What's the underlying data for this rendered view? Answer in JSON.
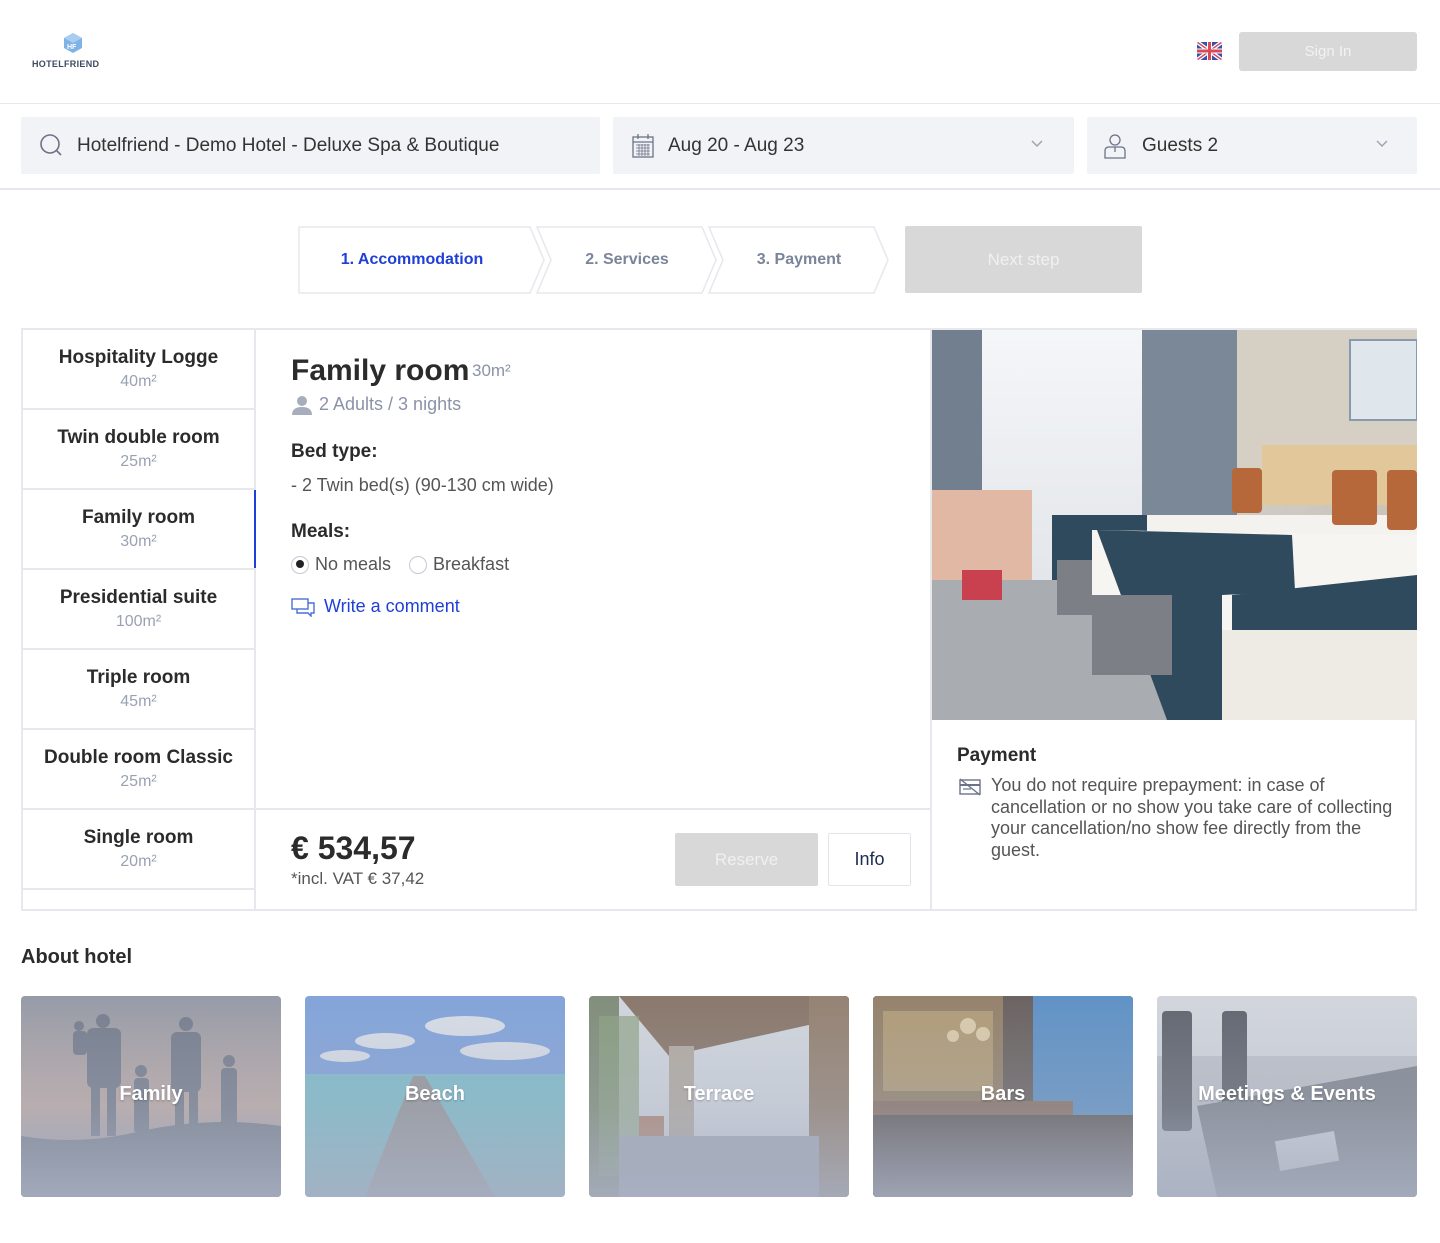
{
  "header": {
    "logo_text": "HOTELFRIEND",
    "language": "English (UK)",
    "sign_in_label": "Sign In"
  },
  "search": {
    "hotel": "Hotelfriend - Demo Hotel - Deluxe Spa & Boutique",
    "dates": "Aug 20 - Aug 23",
    "guests": "Guests 2"
  },
  "steps": [
    {
      "label": "1. Accommodation",
      "active": true
    },
    {
      "label": "2. Services",
      "active": false
    },
    {
      "label": "3. Payment",
      "active": false
    }
  ],
  "next_step_label": "Next step",
  "rooms": [
    {
      "name": "Hospitality Logge",
      "size": "40m²"
    },
    {
      "name": "Twin double room",
      "size": "25m²"
    },
    {
      "name": "Family room",
      "size": "30m²",
      "active": true
    },
    {
      "name": "Presidential suite",
      "size": "100m²"
    },
    {
      "name": "Triple room",
      "size": "45m²"
    },
    {
      "name": "Double room Classic",
      "size": "25m²"
    },
    {
      "name": "Single room",
      "size": "20m²"
    }
  ],
  "selected_room": {
    "title": "Family room",
    "size": "30m²",
    "occupancy": "2 Adults / 3 nights",
    "bed_type_label": "Bed type:",
    "bed_type": "- 2 Twin bed(s) (90-130 cm wide)",
    "meals_label": "Meals:",
    "meal_options": [
      {
        "label": "No meals",
        "selected": true
      },
      {
        "label": "Breakfast",
        "selected": false
      }
    ],
    "comment_link": "Write a comment",
    "price": "€ 534,57",
    "vat": "*incl. VAT € 37,42",
    "reserve_label": "Reserve",
    "info_label": "Info",
    "payment_title": "Payment",
    "payment_text": "You do not require prepayment: in case of cancellation or no show you take care of collecting your cancellation/no show fee directly from the guest."
  },
  "about": {
    "title": "About hotel",
    "tiles": [
      {
        "label": "Family"
      },
      {
        "label": "Beach"
      },
      {
        "label": "Terrace"
      },
      {
        "label": "Bars"
      },
      {
        "label": "Meetings & Events"
      }
    ]
  },
  "colors": {
    "accent": "#1f3fd6",
    "disabled_button": "#d8d8d8",
    "field_bg": "#f2f3f6",
    "muted_text": "#8a93a8",
    "border": "#e6e8ee"
  }
}
